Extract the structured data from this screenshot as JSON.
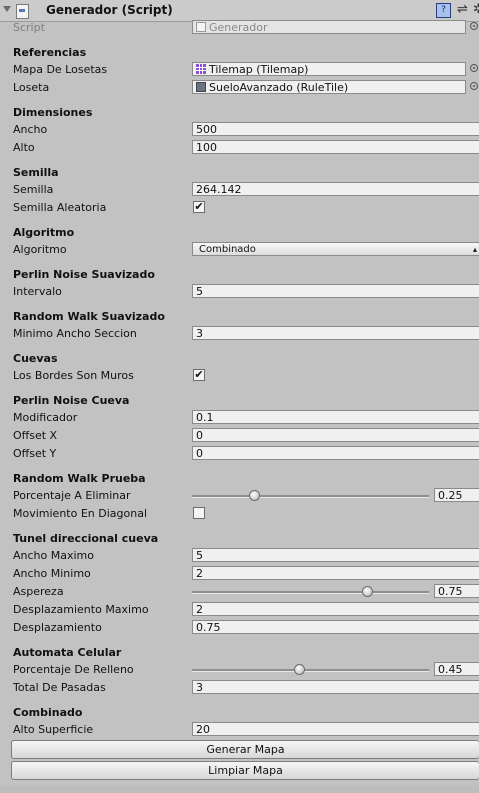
{
  "header": {
    "title": "Generador (Script)"
  },
  "script_row": {
    "label": "Script",
    "value": "Generador"
  },
  "sections": {
    "referencias": "Referencias",
    "dimensiones": "Dimensiones",
    "semilla": "Semilla",
    "algoritmo": "Algoritmo",
    "perlin_suavizado": "Perlin Noise Suavizado",
    "random_walk_suavizado": "Random Walk Suavizado",
    "cuevas": "Cuevas",
    "perlin_cueva": "Perlin Noise Cueva",
    "random_walk_prueba": "Random Walk Prueba",
    "tunel": "Tunel direccional cueva",
    "automata": "Automata Celular",
    "combinado": "Combinado"
  },
  "fields": {
    "mapa_losetas": {
      "label": "Mapa De Losetas",
      "value": "Tilemap (Tilemap)"
    },
    "loseta": {
      "label": "Loseta",
      "value": "SueloAvanzado (RuleTile)"
    },
    "ancho": {
      "label": "Ancho",
      "value": "500"
    },
    "alto": {
      "label": "Alto",
      "value": "100"
    },
    "semilla": {
      "label": "Semilla",
      "value": "264.142"
    },
    "semilla_aleatoria": {
      "label": "Semilla Aleatoria",
      "checked": true
    },
    "algoritmo": {
      "label": "Algoritmo",
      "value": "Combinado"
    },
    "intervalo": {
      "label": "Intervalo",
      "value": "5"
    },
    "minimo_ancho_seccion": {
      "label": "Minimo Ancho Seccion",
      "value": "3"
    },
    "bordes_muros": {
      "label": "Los Bordes Son Muros",
      "checked": true
    },
    "modificador": {
      "label": "Modificador",
      "value": "0.1"
    },
    "offset_x": {
      "label": "Offset X",
      "value": "0"
    },
    "offset_y": {
      "label": "Offset Y",
      "value": "0"
    },
    "porcentaje_eliminar": {
      "label": "Porcentaje A Eliminar",
      "value": "0.25",
      "fraction": 0.25
    },
    "movimiento_diagonal": {
      "label": "Movimiento En Diagonal",
      "checked": false
    },
    "ancho_maximo": {
      "label": "Ancho Maximo",
      "value": "5"
    },
    "ancho_minimo": {
      "label": "Ancho Minimo",
      "value": "2"
    },
    "aspereza": {
      "label": "Aspereza",
      "value": "0.75",
      "fraction": 0.75
    },
    "desplazamiento_maximo": {
      "label": "Desplazamiento Maximo",
      "value": "2"
    },
    "desplazamiento": {
      "label": "Desplazamiento",
      "value": "0.75"
    },
    "porcentaje_relleno": {
      "label": "Porcentaje De Relleno",
      "value": "0.45",
      "fraction": 0.45
    },
    "total_pasadas": {
      "label": "Total De Pasadas",
      "value": "3"
    },
    "alto_superficie": {
      "label": "Alto Superficie",
      "value": "20"
    }
  },
  "buttons": {
    "generar": "Generar Mapa",
    "limpiar": "Limpiar Mapa"
  },
  "icons": {
    "fold": "foldout-arrow-icon",
    "script": "script-icon",
    "help": "help-book-icon",
    "preset": "preset-sliders-icon",
    "settings": "gear-icon",
    "check": "✔",
    "tilemap": "tilemap-icon",
    "ruletile": "ruletile-icon",
    "picker": "object-picker-icon"
  },
  "colors": {
    "panel": "#c2c2c2",
    "field": "#f0f0f0",
    "tilemap_icon": "#8a4fd6"
  }
}
